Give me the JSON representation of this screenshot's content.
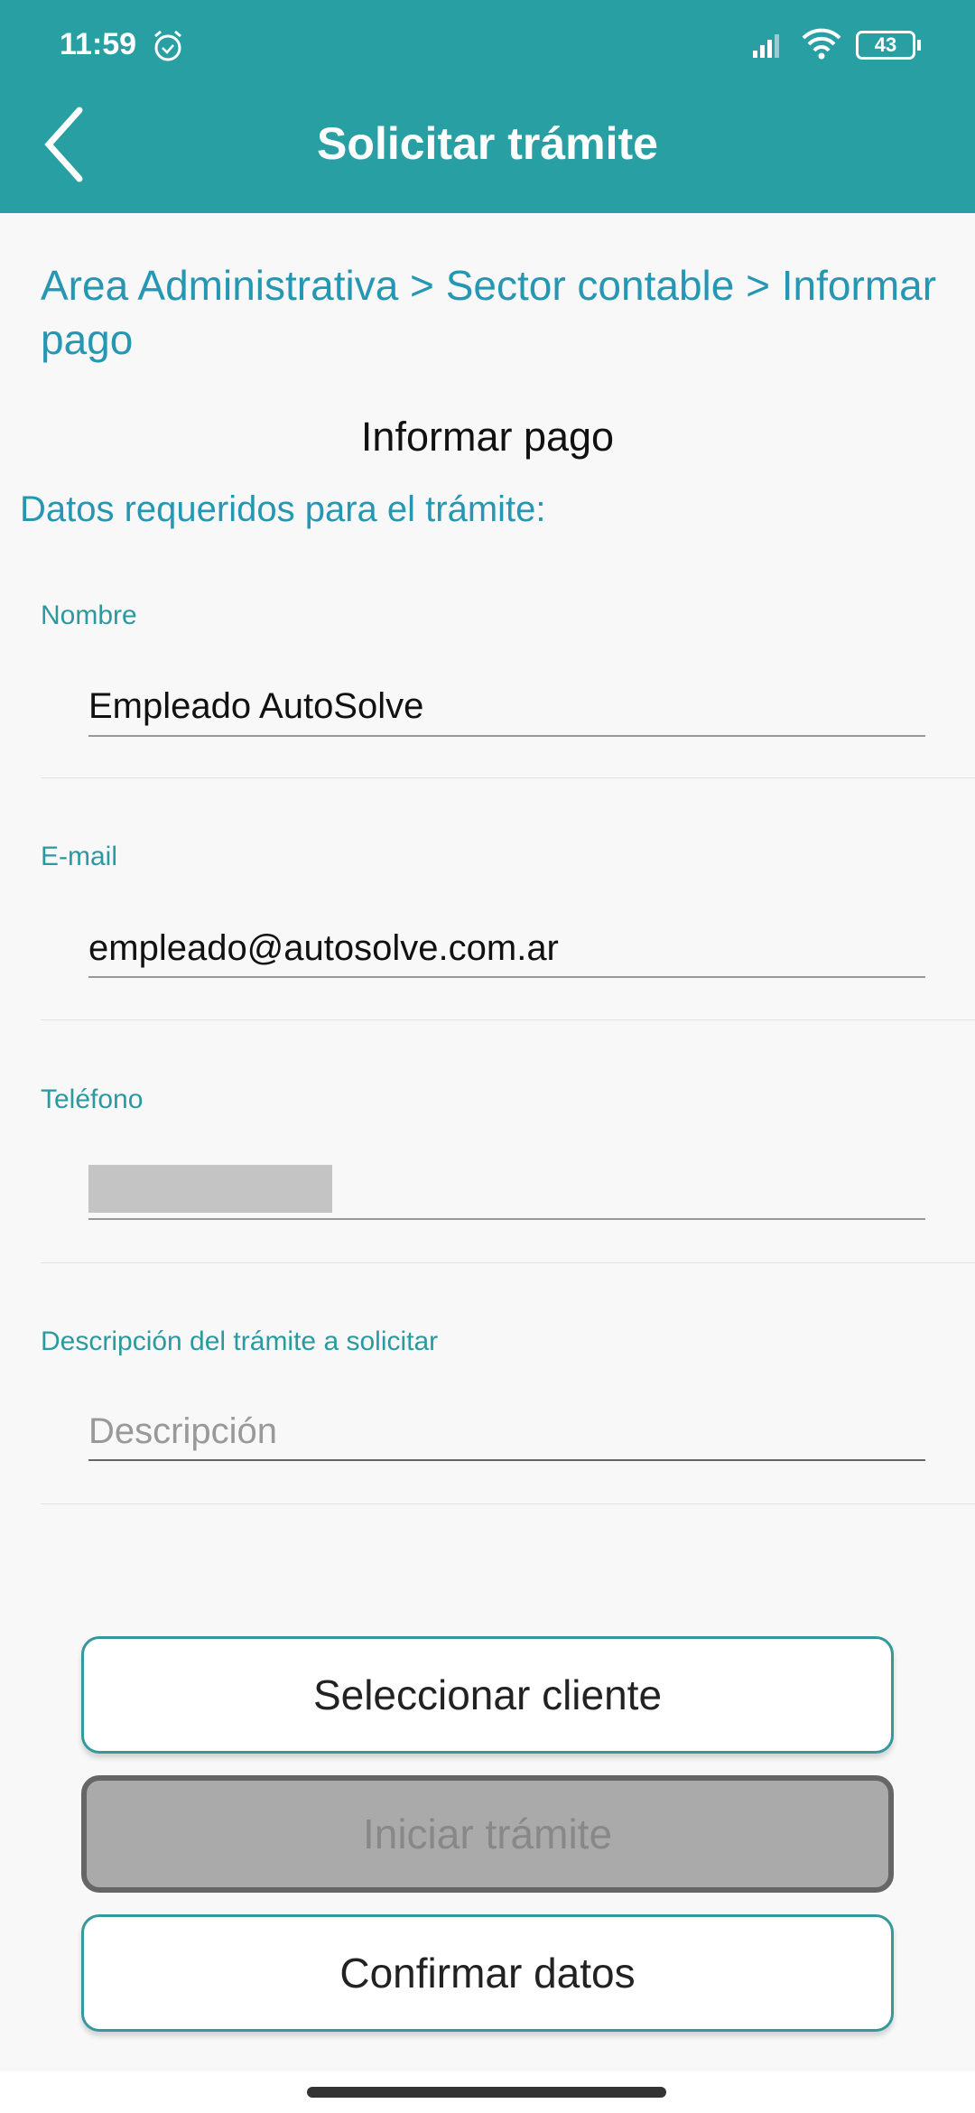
{
  "status_bar": {
    "time": "11:59",
    "battery": "43"
  },
  "header": {
    "title": "Solicitar trámite"
  },
  "breadcrumb": "Area Administrativa > Sector contable > Informar pago",
  "form": {
    "title": "Informar pago",
    "section_title": "Datos requeridos para el trámite:",
    "fields": [
      {
        "label": "Nombre",
        "value": "Empleado AutoSolve"
      },
      {
        "label": "E-mail",
        "value": "empleado@autosolve.com.ar"
      },
      {
        "label": "Teléfono",
        "value": ""
      },
      {
        "label": "Descripción del trámite a solicitar",
        "placeholder": "Descripción"
      }
    ]
  },
  "buttons": {
    "select_client": "Seleccionar cliente",
    "start": "Iniciar trámite",
    "confirm": "Confirmar datos"
  }
}
